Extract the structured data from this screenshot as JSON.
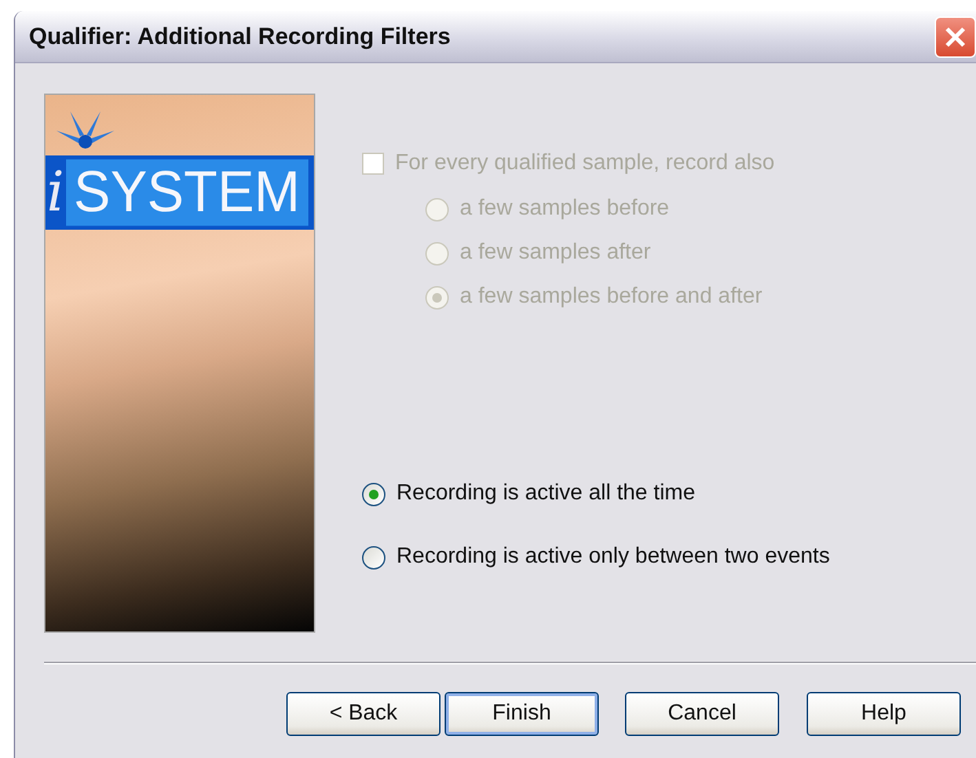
{
  "window": {
    "title": "Qualifier: Additional Recording Filters"
  },
  "logo": {
    "letter": "i",
    "word": "SYSTEM"
  },
  "record_also": {
    "label": "For every qualified sample, record also",
    "checked": false,
    "disabled": true,
    "options": [
      {
        "label": "a few samples before",
        "selected": false
      },
      {
        "label": "a few samples after",
        "selected": false
      },
      {
        "label": "a few samples before and after",
        "selected": true
      }
    ]
  },
  "recording_mode": [
    {
      "label": "Recording is active all the time",
      "selected": true
    },
    {
      "label": "Recording is active only between two events",
      "selected": false
    }
  ],
  "buttons": [
    {
      "label": "< Back",
      "default": false
    },
    {
      "label": "Finish",
      "default": true
    },
    {
      "label": "Cancel",
      "default": false
    },
    {
      "label": "Help",
      "default": false
    }
  ]
}
